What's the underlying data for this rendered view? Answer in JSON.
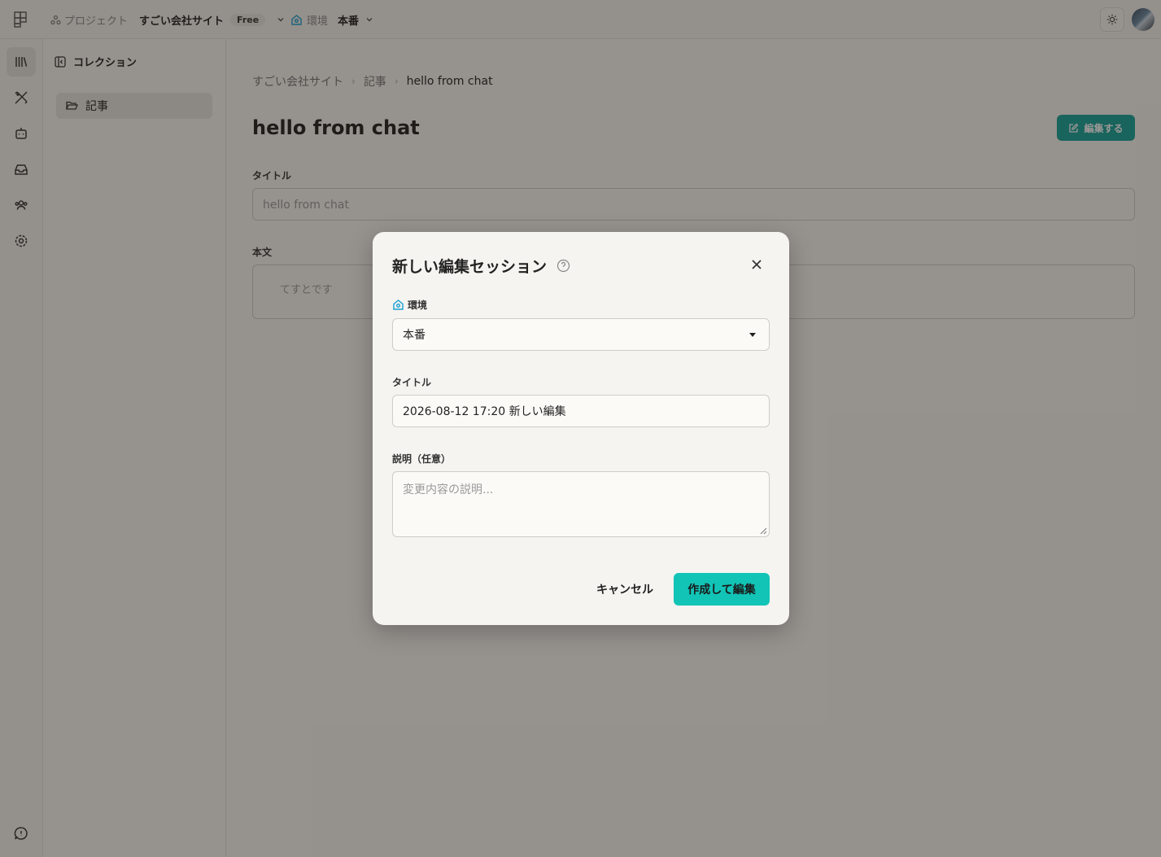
{
  "topbar": {
    "project_label": "プロジェクト",
    "project_name": "すごい会社サイト",
    "plan_badge": "Free",
    "env_label": "環境",
    "env_name": "本番",
    "icons": [
      "app-logo-icon",
      "project-icon",
      "chevron-down-icon",
      "environment-icon",
      "sun-icon",
      "avatar"
    ]
  },
  "rail": {
    "icons": [
      "library-icon",
      "design-tools-icon",
      "bot-icon",
      "inbox-icon",
      "users-icon",
      "gear-icon",
      "feedback-icon"
    ]
  },
  "collections": {
    "header": "コレクション",
    "items": [
      {
        "label": "記事",
        "icon": "folder-open-icon"
      }
    ]
  },
  "main": {
    "breadcrumb": [
      "すごい会社サイト",
      "記事",
      "hello from chat"
    ],
    "title": "hello from chat",
    "edit_button": "編集する",
    "fields": {
      "title_label": "タイトル",
      "title_value": "hello from chat",
      "body_label": "本文",
      "body_value": "てすとです"
    }
  },
  "modal": {
    "title": "新しい編集セッション",
    "env_label": "環境",
    "env_value": "本番",
    "title_label": "タイトル",
    "title_value": "2026-08-12 17:20 新しい編集",
    "desc_label": "説明（任意）",
    "desc_placeholder": "変更内容の説明...",
    "cancel": "キャンセル",
    "submit": "作成して編集"
  },
  "colors": {
    "accent": "#12c4b6",
    "edit_button": "#14a39a",
    "env_icon": "#1a9fd4"
  }
}
